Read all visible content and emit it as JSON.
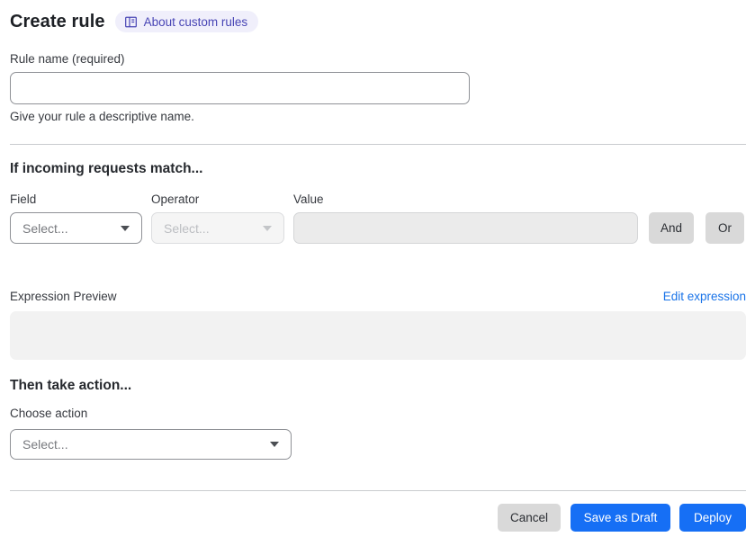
{
  "colors": {
    "accent_blue": "#166ff5",
    "link_blue": "#1973e8",
    "badge_bg": "#f0effb",
    "badge_text": "#4845b5",
    "gray_button_bg": "#d9d9d9",
    "disabled_field_bg": "#ebebeb",
    "preview_bg": "#f2f2f2"
  },
  "header": {
    "title": "Create rule",
    "about_badge_label": "About custom rules"
  },
  "rule_name": {
    "label": "Rule name (required)",
    "value": "",
    "helper": "Give your rule a descriptive name."
  },
  "match": {
    "heading": "If incoming requests match...",
    "field_label": "Field",
    "field_value": "Select...",
    "operator_label": "Operator",
    "operator_value": "Select...",
    "value_label": "Value",
    "value_text": "",
    "and_button": "And",
    "or_button": "Or"
  },
  "expression": {
    "label": "Expression Preview",
    "edit_link": "Edit expression",
    "content": ""
  },
  "action": {
    "heading": "Then take action...",
    "choose_label": "Choose action",
    "value": "Select..."
  },
  "footer": {
    "cancel": "Cancel",
    "save_as_draft": "Save as Draft",
    "deploy": "Deploy"
  }
}
